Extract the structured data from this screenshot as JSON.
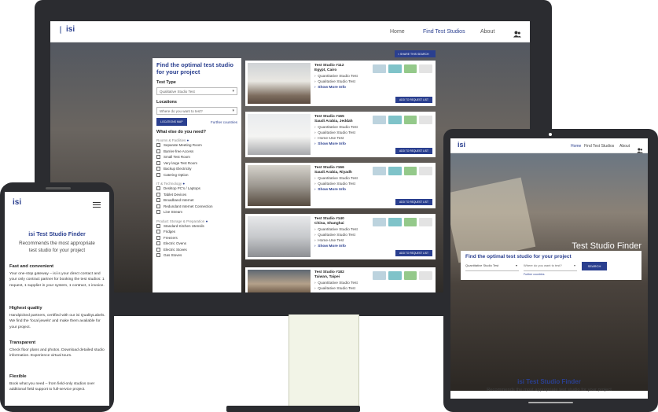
{
  "brand": {
    "logo_text": "isi",
    "accent": "#2a3f8f"
  },
  "desktop": {
    "nav": {
      "home": "Home",
      "find": "Find Test Studios",
      "about": "About",
      "user_icon": "user-group-icon"
    },
    "share_label": "SHARE THIS SEARCH",
    "panel": {
      "heading": "Find the optimal test studio for your project",
      "test_type_label": "Test Type",
      "test_type_value": "Qualitative Studio Test",
      "locations_label": "Locations",
      "locations_placeholder": "Where do you want to test?",
      "map_button": "LOCATIONS MAP",
      "further_link": "Further countries",
      "what_else": "What else do you need?",
      "categories": [
        {
          "name": "Rooms & Facilities",
          "items": [
            "Separate Meeting Room",
            "Barrier-free Access",
            "Small Test Room",
            "Very large Test Room",
            "Backup Electricity",
            "Catering Option"
          ]
        },
        {
          "name": "IT & Technology",
          "items": [
            "Desktop PC's / Laptops",
            "Tablet Devices",
            "Broadband Internet",
            "Redundant Internet Connection",
            "Live Stream"
          ]
        },
        {
          "name": "Product Storage & Preparation",
          "items": [
            "Standard Kitchen Utensils",
            "Fridges",
            "Freezers",
            "Electric Ovens",
            "Electric Stoves",
            "Gas Stoves"
          ]
        }
      ]
    },
    "studios": [
      {
        "title": "Test Studio #112",
        "location": "Egypt, Cairo",
        "items": [
          "Quantitative Studio Test",
          "Qualitative Studio Test"
        ],
        "more": "Show More Info",
        "button": "ADD TO REQUEST LIST"
      },
      {
        "title": "Test Studio #165",
        "location": "Saudi Arabia, Jeddah",
        "items": [
          "Quantitative Studio Test",
          "Qualitative Studio Test",
          "Home-Use Test"
        ],
        "more": "Show More Info",
        "button": "ADD TO REQUEST LIST"
      },
      {
        "title": "Test Studio #166",
        "location": "Saudi Arabia, Riyadh",
        "items": [
          "Quantitative Studio Test",
          "Qualitative Studio Test"
        ],
        "more": "Show More Info",
        "button": "ADD TO REQUEST LIST"
      },
      {
        "title": "Test Studio #140",
        "location": "China, Shanghai",
        "items": [
          "Quantitative Studio Test",
          "Qualitative Studio Test",
          "Home-Use Test"
        ],
        "more": "Show More Info",
        "button": "ADD TO REQUEST LIST"
      },
      {
        "title": "Test Studio #182",
        "location": "Taiwan, Taipei",
        "items": [
          "Quantitative Studio Test",
          "Qualitative Studio Test"
        ],
        "more": "Show More Info",
        "button": "ADD TO REQUEST LIST"
      }
    ]
  },
  "tablet": {
    "nav": {
      "home": "Home",
      "find": "Find Test Studios",
      "about": "About"
    },
    "hero_title": "Test Studio Finder",
    "finder_heading": "Find the optimal test studio for your project",
    "test_type_value": "Quantitative Studio Test",
    "location_placeholder": "Where do you want to test?",
    "search_button": "SEARCH",
    "further_link": "Further countries",
    "footer_title": "isi Test Studio Finder",
    "footer_sub": "Recommends the most appropriate test studio for your project"
  },
  "phone": {
    "title": "isi Test Studio Finder",
    "subtitle": "Recommends the most appropriate test studio for your project",
    "features": [
      {
        "h": "Fast and convenient",
        "b": "Your one-stop gateway – isi is your direct contact and your only contract partner for booking the test studios: 1 request, 1 supplier in your system, 1 contract, 1 invoice."
      },
      {
        "h": "Highest quality",
        "b": "Handpicked partners, certified with our isi QualityLabels. We find the 'local jewels' and make them available for your project."
      },
      {
        "h": "Transparent",
        "b": "Check floor plans and photos. Download detailed studio information. Experience virtual tours."
      },
      {
        "h": "Flexible",
        "b": "Book what you need – from field-only studios over additional field support to full-service project."
      }
    ]
  }
}
